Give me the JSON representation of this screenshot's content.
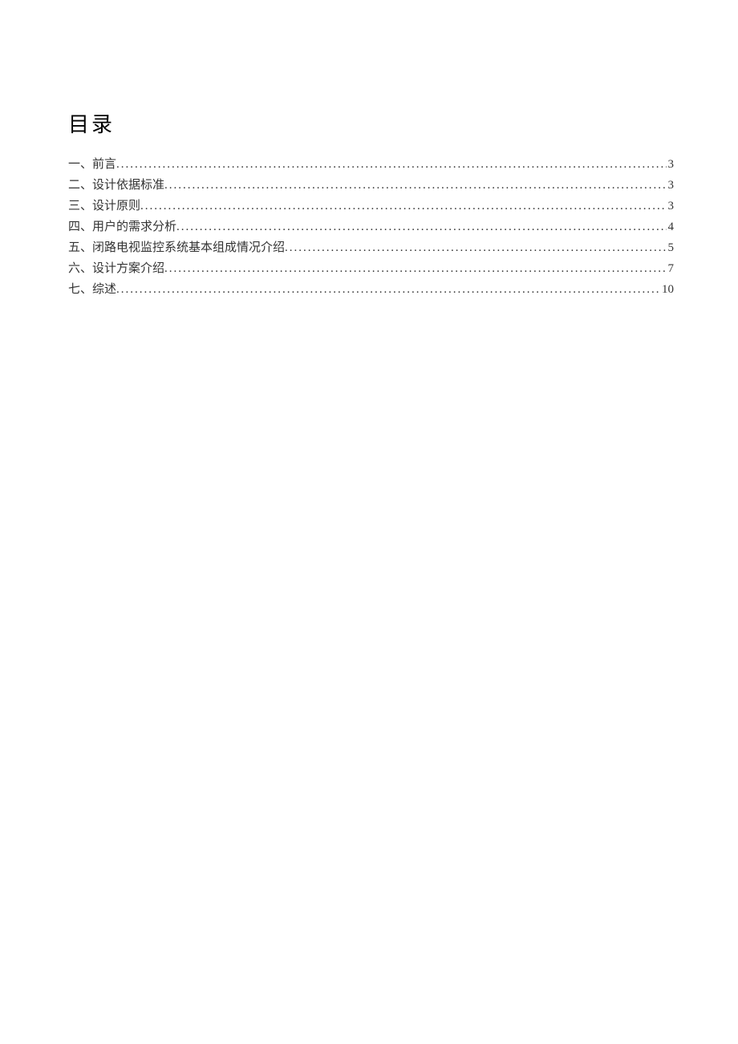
{
  "title": "目录",
  "entries": [
    {
      "label": "一、前言",
      "page": "3"
    },
    {
      "label": "二、设计依据标准",
      "page": "3"
    },
    {
      "label": "三、设计原则",
      "page": "3"
    },
    {
      "label": "四、用户的需求分析",
      "page": "4"
    },
    {
      "label": "五、闭路电视监控系统基本组成情况介绍",
      "page": "5"
    },
    {
      "label": "六、设计方案介绍",
      "page": "7"
    },
    {
      "label": "七、综述",
      "page": "10"
    }
  ]
}
